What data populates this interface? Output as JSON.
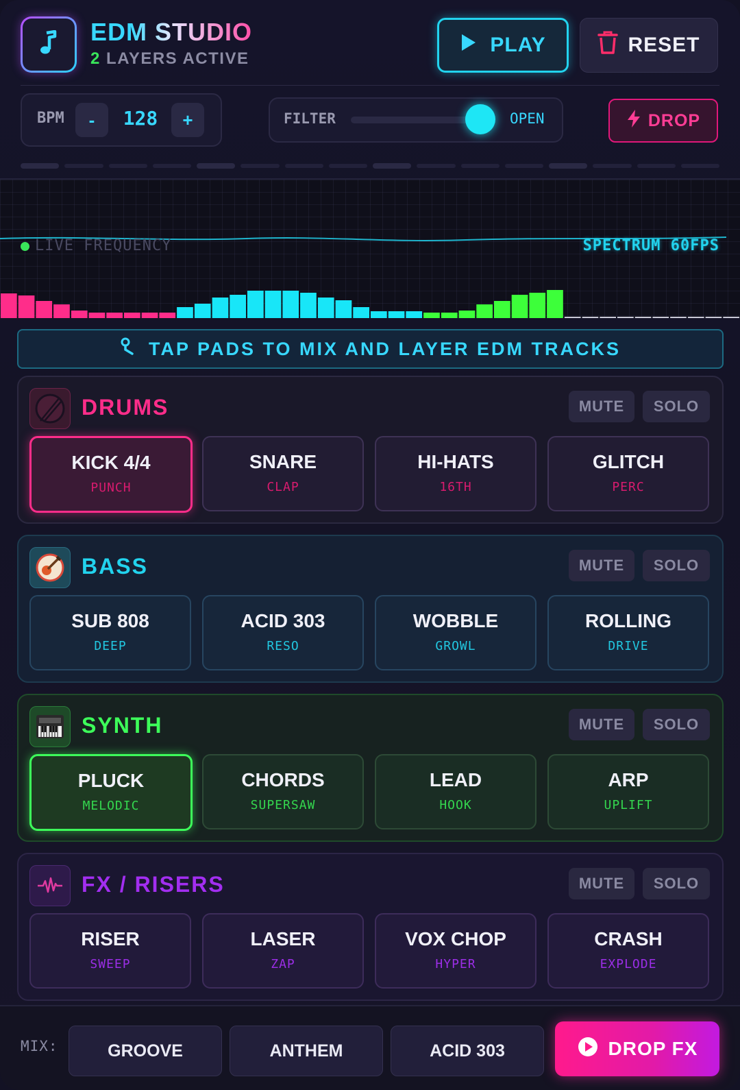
{
  "header": {
    "title": "EDM STUDIO",
    "layers_count": "2",
    "layers_label": "LAYERS ACTIVE",
    "play_label": "PLAY",
    "reset_label": "RESET",
    "logo_icon": "music-note-icon"
  },
  "controls": {
    "bpm_label": "BPM",
    "bpm_minus": "-",
    "bpm_value": "128",
    "bpm_plus": "+",
    "filter_label": "FILTER",
    "filter_state": "OPEN",
    "filter_level": 0.9,
    "drop_label": "DROP"
  },
  "visualizer": {
    "live_label": "LIVE FREQUENCY",
    "spectrum_label": "SPECTRUM 60FPS",
    "bar_levels": [
      0.72,
      0.66,
      0.5,
      0.4,
      0.22,
      0.16,
      0.16,
      0.16,
      0.16,
      0.16,
      0.32,
      0.42,
      0.6,
      0.68,
      0.8,
      0.8,
      0.8,
      0.74,
      0.6,
      0.52,
      0.32,
      0.2,
      0.2,
      0.2,
      0.16,
      0.16,
      0.22,
      0.4,
      0.5,
      0.68,
      0.74,
      0.82,
      0.02,
      0.02,
      0.02,
      0.02,
      0.02,
      0.02,
      0.02,
      0.02,
      0.02,
      0.02
    ],
    "bar_colors": [
      "#ff2d8a",
      "#ff2d8a",
      "#ff2d8a",
      "#ff2d8a",
      "#ff2d8a",
      "#ff2d8a",
      "#ff2d8a",
      "#ff2d8a",
      "#ff2d8a",
      "#ff2d8a",
      "#18e6f8",
      "#18e6f8",
      "#18e6f8",
      "#18e6f8",
      "#18e6f8",
      "#18e6f8",
      "#18e6f8",
      "#18e6f8",
      "#18e6f8",
      "#18e6f8",
      "#18e6f8",
      "#18e6f8",
      "#18e6f8",
      "#18e6f8",
      "#3dff3a",
      "#3dff3a",
      "#3dff3a",
      "#3dff3a",
      "#3dff3a",
      "#3dff3a",
      "#3dff3a",
      "#3dff3a",
      "#c9c9d6",
      "#c9c9d6",
      "#c9c9d6",
      "#c9c9d6",
      "#c9c9d6",
      "#c9c9d6",
      "#c9c9d6",
      "#c9c9d6",
      "#c9c9d6",
      "#c9c9d6"
    ]
  },
  "tip": {
    "icon": "tap-hand-icon",
    "text": "TAP PADS TO MIX AND LAYER EDM TRACKS"
  },
  "sections": [
    {
      "title": "DRUMS",
      "color": "#ff2d8a",
      "icon": "drum-icon",
      "mute": "MUTE",
      "solo": "SOLO",
      "pads": [
        {
          "name": "KICK 4/4",
          "sub": "PUNCH",
          "active": true
        },
        {
          "name": "SNARE",
          "sub": "CLAP"
        },
        {
          "name": "HI-HATS",
          "sub": "16TH"
        },
        {
          "name": "GLITCH",
          "sub": "PERC"
        }
      ]
    },
    {
      "title": "BASS",
      "color": "#22d3ee",
      "icon": "guitar-icon",
      "mute": "MUTE",
      "solo": "SOLO",
      "pads": [
        {
          "name": "SUB 808",
          "sub": "DEEP"
        },
        {
          "name": "ACID 303",
          "sub": "RESO"
        },
        {
          "name": "WOBBLE",
          "sub": "GROWL"
        },
        {
          "name": "ROLLING",
          "sub": "DRIVE"
        }
      ]
    },
    {
      "title": "SYNTH",
      "color": "#3dff5a",
      "icon": "keyboard-icon",
      "mute": "MUTE",
      "solo": "SOLO",
      "pads": [
        {
          "name": "PLUCK",
          "sub": "MELODIC",
          "active": true
        },
        {
          "name": "CHORDS",
          "sub": "SUPERSAW"
        },
        {
          "name": "LEAD",
          "sub": "HOOK"
        },
        {
          "name": "ARP",
          "sub": "UPLIFT"
        }
      ]
    },
    {
      "title": "FX / RISERS",
      "color": "#a22ef0",
      "icon": "waveform-icon",
      "mute": "MUTE",
      "solo": "SOLO",
      "pads": [
        {
          "name": "RISER",
          "sub": "SWEEP"
        },
        {
          "name": "LASER",
          "sub": "ZAP"
        },
        {
          "name": "VOX CHOP",
          "sub": "HYPER"
        },
        {
          "name": "CRASH",
          "sub": "EXPLODE"
        }
      ]
    }
  ],
  "footer": {
    "mix_label": "MIX:",
    "presets": [
      "GROOVE",
      "ANTHEM",
      "ACID 303"
    ],
    "drop_fx_label": "DROP FX"
  }
}
